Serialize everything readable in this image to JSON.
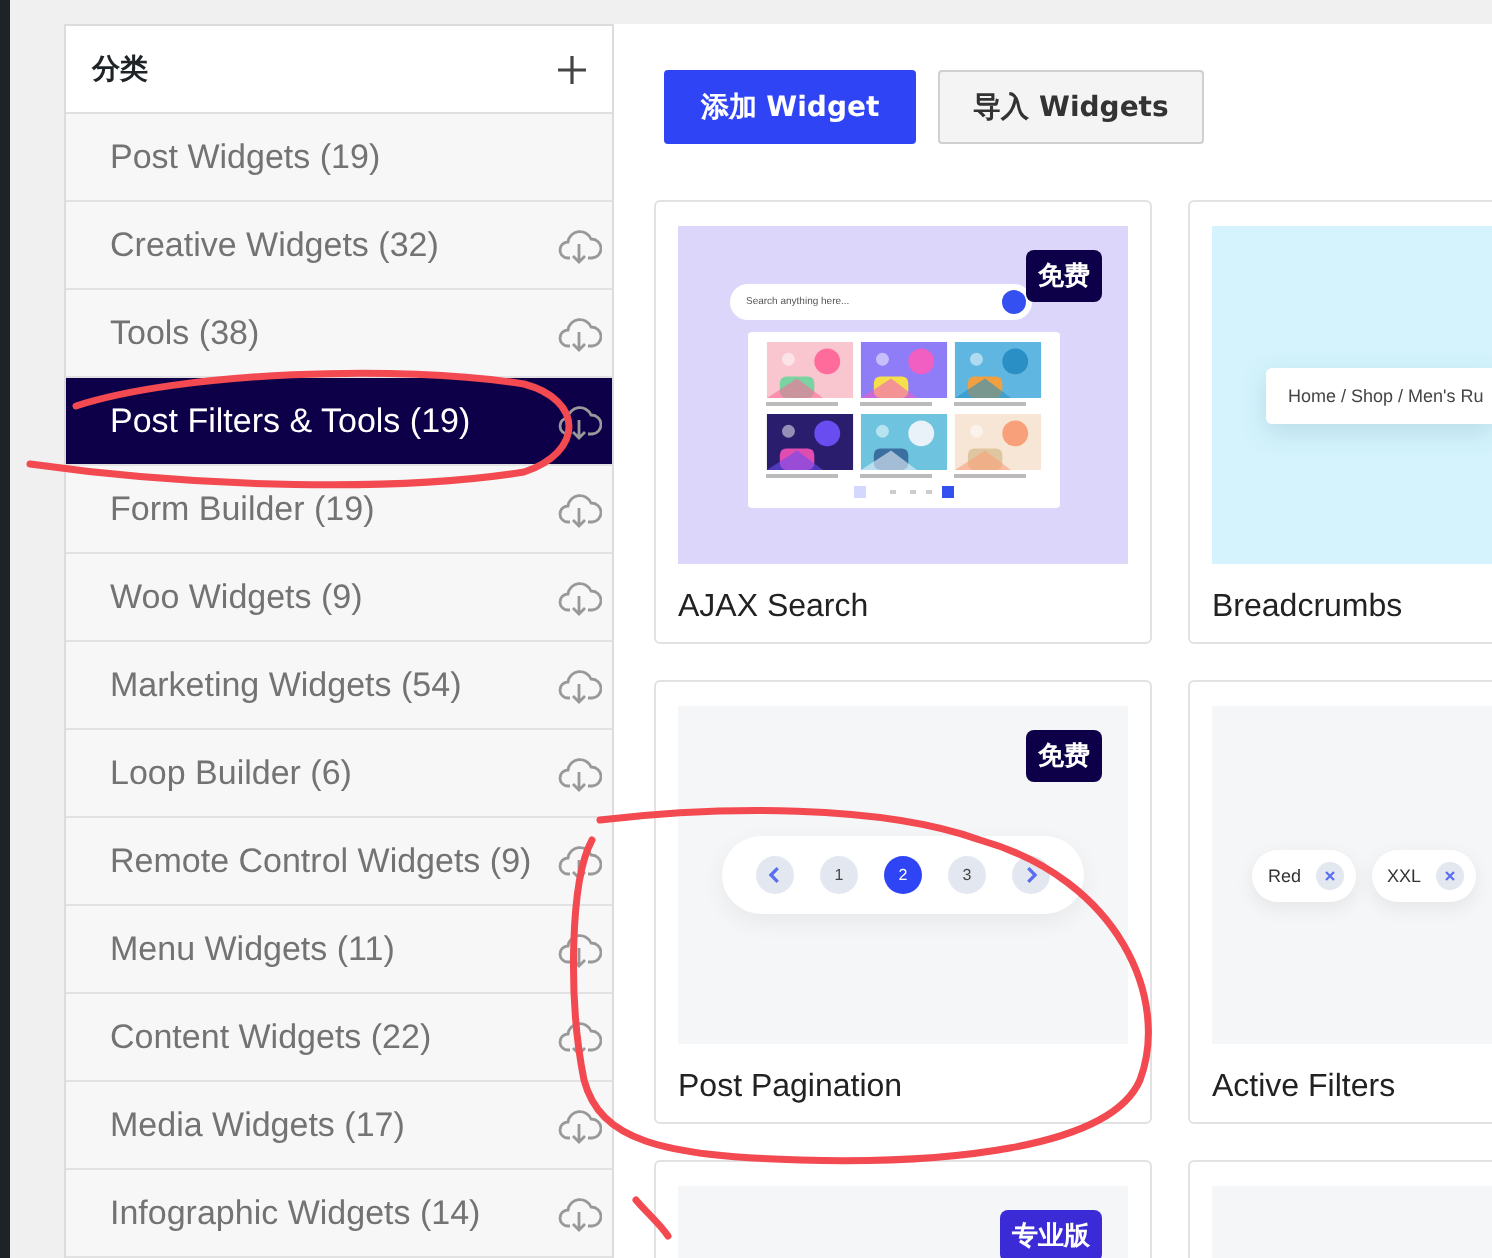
{
  "sidebar": {
    "title": "分类",
    "items": [
      {
        "label": "Post Widgets (19)",
        "selected": false,
        "download_icon": false
      },
      {
        "label": "Creative Widgets (32)",
        "selected": false,
        "download_icon": true
      },
      {
        "label": "Tools (38)",
        "selected": false,
        "download_icon": true
      },
      {
        "label": "Post Filters & Tools (19)",
        "selected": true,
        "download_icon": true
      },
      {
        "label": "Form Builder (19)",
        "selected": false,
        "download_icon": true
      },
      {
        "label": "Woo Widgets (9)",
        "selected": false,
        "download_icon": true
      },
      {
        "label": "Marketing Widgets (54)",
        "selected": false,
        "download_icon": true
      },
      {
        "label": "Loop Builder (6)",
        "selected": false,
        "download_icon": true
      },
      {
        "label": "Remote Control Widgets (9)",
        "selected": false,
        "download_icon": true
      },
      {
        "label": "Menu Widgets (11)",
        "selected": false,
        "download_icon": true
      },
      {
        "label": "Content Widgets (22)",
        "selected": false,
        "download_icon": true
      },
      {
        "label": "Media Widgets (17)",
        "selected": false,
        "download_icon": true
      },
      {
        "label": "Infographic Widgets (14)",
        "selected": false,
        "download_icon": true
      }
    ]
  },
  "toolbar": {
    "buttons": [
      {
        "label": "添加 Widget",
        "kind": "primary"
      },
      {
        "label": "导入 Widgets",
        "kind": "secondary"
      }
    ]
  },
  "cards": [
    {
      "title": "AJAX Search",
      "badge": {
        "label": "免费",
        "kind": "free"
      },
      "preview": {
        "kind": "search",
        "placeholder": "Search anything here..."
      }
    },
    {
      "title": "Breadcrumbs",
      "preview": {
        "kind": "breadcrumbs",
        "text": "Home / Shop / Men's Ru"
      }
    },
    {
      "title": "Post Pagination",
      "badge": {
        "label": "免费",
        "kind": "free"
      },
      "preview": {
        "kind": "pagination",
        "pages": [
          {
            "label": "1",
            "selected": false
          },
          {
            "label": "2",
            "selected": true
          },
          {
            "label": "3",
            "selected": false
          }
        ]
      }
    },
    {
      "title": "Active Filters",
      "preview": {
        "kind": "filters",
        "chips": [
          "Red",
          "XXL"
        ]
      }
    },
    {
      "badge": {
        "label": "专业版",
        "kind": "pro"
      },
      "preview": {
        "kind": "blank"
      }
    },
    {
      "preview": {
        "kind": "blank"
      }
    }
  ]
}
